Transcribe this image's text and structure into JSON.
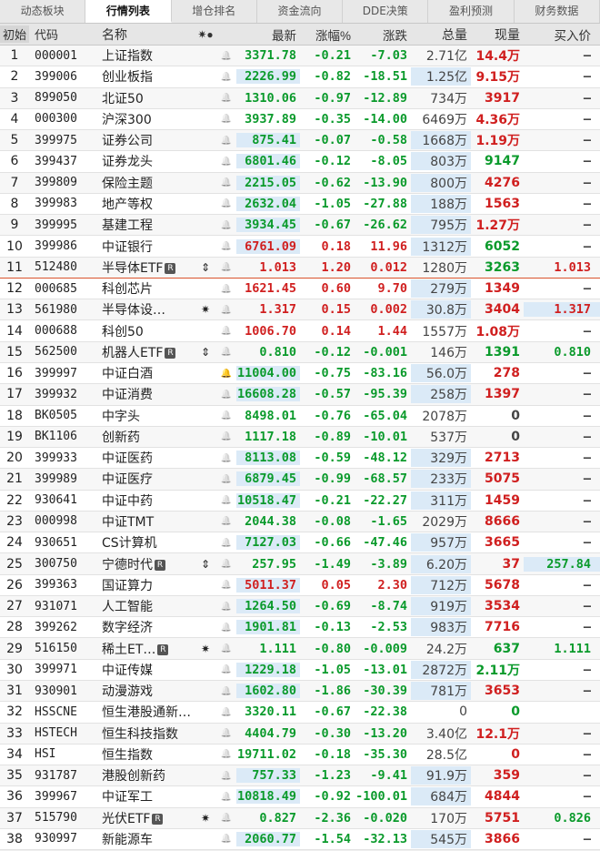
{
  "tabs": [
    "动态板块",
    "行情列表",
    "增仓排名",
    "资金流向",
    "DDE决策",
    "盈利预测",
    "财务数据"
  ],
  "active_tab": 1,
  "header": {
    "idx": "初始",
    "code": "代码",
    "name": "名称",
    "mark": "✷●",
    "latest": "最新",
    "pct": "涨幅%",
    "chg": "涨跌",
    "vol": "总量",
    "cur": "现量",
    "buy": "买入价"
  },
  "colors": {
    "up": "#d01f1f",
    "down": "#0a9a2b",
    "highlight": "#dbeaf7",
    "separator": "#d9532c"
  },
  "rows": [
    {
      "i": "1",
      "code": "000001",
      "name": "上证指数",
      "mark": "",
      "bell": "off",
      "latest": "3371.78",
      "pct": "-0.21",
      "chg": "-7.03",
      "vol": "2.71亿",
      "cur": "14.4万",
      "cur_c": "red",
      "buy": "—",
      "dir": "down",
      "hl": []
    },
    {
      "i": "2",
      "code": "399006",
      "name": "创业板指",
      "mark": "",
      "bell": "off",
      "latest": "2226.99",
      "pct": "-0.82",
      "chg": "-18.51",
      "vol": "1.25亿",
      "cur": "9.15万",
      "cur_c": "red",
      "buy": "—",
      "dir": "down",
      "hl": [
        "latest",
        "vol"
      ]
    },
    {
      "i": "3",
      "code": "899050",
      "name": "北证50",
      "mark": "",
      "bell": "off",
      "latest": "1310.06",
      "pct": "-0.97",
      "chg": "-12.89",
      "vol": "734万",
      "cur": "3917",
      "cur_c": "red",
      "buy": "—",
      "dir": "down",
      "hl": []
    },
    {
      "i": "4",
      "code": "000300",
      "name": "沪深300",
      "mark": "",
      "bell": "off",
      "latest": "3937.89",
      "pct": "-0.35",
      "chg": "-14.00",
      "vol": "6469万",
      "cur": "4.36万",
      "cur_c": "red",
      "buy": "—",
      "dir": "down",
      "hl": []
    },
    {
      "i": "5",
      "code": "399975",
      "name": "证券公司",
      "mark": "",
      "bell": "off",
      "latest": "875.41",
      "pct": "-0.07",
      "chg": "-0.58",
      "vol": "1668万",
      "cur": "1.19万",
      "cur_c": "red",
      "buy": "—",
      "dir": "down",
      "hl": [
        "latest",
        "vol"
      ]
    },
    {
      "i": "6",
      "code": "399437",
      "name": "证券龙头",
      "mark": "",
      "bell": "off",
      "latest": "6801.46",
      "pct": "-0.12",
      "chg": "-8.05",
      "vol": "803万",
      "cur": "9147",
      "cur_c": "green",
      "buy": "—",
      "dir": "down",
      "hl": [
        "latest",
        "vol"
      ]
    },
    {
      "i": "7",
      "code": "399809",
      "name": "保险主题",
      "mark": "",
      "bell": "off",
      "latest": "2215.05",
      "pct": "-0.62",
      "chg": "-13.90",
      "vol": "800万",
      "cur": "4276",
      "cur_c": "red",
      "buy": "—",
      "dir": "down",
      "hl": [
        "latest",
        "vol"
      ]
    },
    {
      "i": "8",
      "code": "399983",
      "name": "地产等权",
      "mark": "",
      "bell": "off",
      "latest": "2632.04",
      "pct": "-1.05",
      "chg": "-27.88",
      "vol": "188万",
      "cur": "1563",
      "cur_c": "red",
      "buy": "—",
      "dir": "down",
      "hl": [
        "latest",
        "vol"
      ]
    },
    {
      "i": "9",
      "code": "399995",
      "name": "基建工程",
      "mark": "",
      "bell": "off",
      "latest": "3934.45",
      "pct": "-0.67",
      "chg": "-26.62",
      "vol": "795万",
      "cur": "1.27万",
      "cur_c": "red",
      "buy": "—",
      "dir": "down",
      "hl": [
        "latest",
        "vol"
      ]
    },
    {
      "i": "10",
      "code": "399986",
      "name": "中证银行",
      "mark": "",
      "bell": "off",
      "latest": "6761.09",
      "pct": "0.18",
      "chg": "11.96",
      "vol": "1312万",
      "cur": "6052",
      "cur_c": "green",
      "buy": "—",
      "dir": "up",
      "hl": [
        "latest",
        "vol"
      ]
    },
    {
      "i": "11",
      "code": "512480",
      "name": "半导体ETF",
      "badge": "R",
      "mark": "⇕",
      "bell": "off",
      "latest": "1.013",
      "pct": "1.20",
      "chg": "0.012",
      "vol": "1280万",
      "cur": "3263",
      "cur_c": "green",
      "buy": "1.013",
      "buy_c": "red",
      "dir": "up",
      "hl": []
    },
    {
      "i": "12",
      "code": "000685",
      "name": "科创芯片",
      "mark": "",
      "bell": "off",
      "latest": "1621.45",
      "pct": "0.60",
      "chg": "9.70",
      "vol": "279万",
      "cur": "1349",
      "cur_c": "red",
      "buy": "—",
      "dir": "up",
      "hl": [
        "vol"
      ]
    },
    {
      "i": "13",
      "code": "561980",
      "name": "半导体设…",
      "mark": "✷",
      "bell": "off",
      "latest": "1.317",
      "pct": "0.15",
      "chg": "0.002",
      "vol": "30.8万",
      "cur": "3404",
      "cur_c": "red",
      "buy": "1.317",
      "buy_c": "red",
      "dir": "up",
      "hl": [
        "vol",
        "buy"
      ]
    },
    {
      "i": "14",
      "code": "000688",
      "name": "科创50",
      "mark": "",
      "bell": "off",
      "latest": "1006.70",
      "pct": "0.14",
      "chg": "1.44",
      "vol": "1557万",
      "cur": "1.08万",
      "cur_c": "red",
      "buy": "—",
      "dir": "up",
      "hl": []
    },
    {
      "i": "15",
      "code": "562500",
      "name": "机器人ETF",
      "badge": "R",
      "mark": "⇕",
      "bell": "off",
      "latest": "0.810",
      "pct": "-0.12",
      "chg": "-0.001",
      "vol": "146万",
      "cur": "1391",
      "cur_c": "green",
      "buy": "0.810",
      "buy_c": "green",
      "dir": "down",
      "hl": []
    },
    {
      "i": "16",
      "code": "399997",
      "name": "中证白酒",
      "mark": "",
      "bell": "on",
      "latest": "11004.00",
      "pct": "-0.75",
      "chg": "-83.16",
      "vol": "56.0万",
      "cur": "278",
      "cur_c": "red",
      "buy": "—",
      "dir": "down",
      "hl": [
        "latest",
        "vol"
      ]
    },
    {
      "i": "17",
      "code": "399932",
      "name": "中证消费",
      "mark": "",
      "bell": "off",
      "latest": "16608.28",
      "pct": "-0.57",
      "chg": "-95.39",
      "vol": "258万",
      "cur": "1397",
      "cur_c": "red",
      "buy": "—",
      "dir": "down",
      "hl": [
        "latest",
        "vol"
      ]
    },
    {
      "i": "18",
      "code": "BK0505",
      "name": "中字头",
      "mark": "",
      "bell": "off",
      "latest": "8498.01",
      "pct": "-0.76",
      "chg": "-65.04",
      "vol": "2078万",
      "cur": "0",
      "cur_c": "gray",
      "buy": "—",
      "dir": "down",
      "hl": []
    },
    {
      "i": "19",
      "code": "BK1106",
      "name": "创新药",
      "mark": "",
      "bell": "off",
      "latest": "1117.18",
      "pct": "-0.89",
      "chg": "-10.01",
      "vol": "537万",
      "cur": "0",
      "cur_c": "gray",
      "buy": "—",
      "dir": "down",
      "hl": []
    },
    {
      "i": "20",
      "code": "399933",
      "name": "中证医药",
      "mark": "",
      "bell": "off",
      "latest": "8113.08",
      "pct": "-0.59",
      "chg": "-48.12",
      "vol": "329万",
      "cur": "2713",
      "cur_c": "red",
      "buy": "—",
      "dir": "down",
      "hl": [
        "latest",
        "vol"
      ]
    },
    {
      "i": "21",
      "code": "399989",
      "name": "中证医疗",
      "mark": "",
      "bell": "off",
      "latest": "6879.45",
      "pct": "-0.99",
      "chg": "-68.57",
      "vol": "233万",
      "cur": "5075",
      "cur_c": "red",
      "buy": "—",
      "dir": "down",
      "hl": [
        "latest",
        "vol"
      ]
    },
    {
      "i": "22",
      "code": "930641",
      "name": "中证中药",
      "mark": "",
      "bell": "off",
      "latest": "10518.47",
      "pct": "-0.21",
      "chg": "-22.27",
      "vol": "311万",
      "cur": "1459",
      "cur_c": "red",
      "buy": "—",
      "dir": "down",
      "hl": [
        "latest",
        "vol"
      ]
    },
    {
      "i": "23",
      "code": "000998",
      "name": "中证TMT",
      "mark": "",
      "bell": "off",
      "latest": "2044.38",
      "pct": "-0.08",
      "chg": "-1.65",
      "vol": "2029万",
      "cur": "8666",
      "cur_c": "red",
      "buy": "—",
      "dir": "down",
      "hl": []
    },
    {
      "i": "24",
      "code": "930651",
      "name": "CS计算机",
      "mark": "",
      "bell": "off",
      "latest": "7127.03",
      "pct": "-0.66",
      "chg": "-47.46",
      "vol": "957万",
      "cur": "3665",
      "cur_c": "red",
      "buy": "—",
      "dir": "down",
      "hl": [
        "latest",
        "vol"
      ]
    },
    {
      "i": "25",
      "code": "300750",
      "name": "宁德时代",
      "badge": "R",
      "mark": "⇕",
      "bell": "off",
      "latest": "257.95",
      "pct": "-1.49",
      "chg": "-3.89",
      "vol": "6.20万",
      "cur": "37",
      "cur_c": "red",
      "buy": "257.84",
      "buy_c": "green",
      "dir": "down",
      "hl": [
        "vol",
        "buy"
      ]
    },
    {
      "i": "26",
      "code": "399363",
      "name": "国证算力",
      "mark": "",
      "bell": "off",
      "latest": "5011.37",
      "pct": "0.05",
      "chg": "2.30",
      "vol": "712万",
      "cur": "5678",
      "cur_c": "red",
      "buy": "—",
      "dir": "up",
      "hl": [
        "latest",
        "vol"
      ]
    },
    {
      "i": "27",
      "code": "931071",
      "name": "人工智能",
      "mark": "",
      "bell": "off",
      "latest": "1264.50",
      "pct": "-0.69",
      "chg": "-8.74",
      "vol": "919万",
      "cur": "3534",
      "cur_c": "red",
      "buy": "—",
      "dir": "down",
      "hl": [
        "latest",
        "vol"
      ]
    },
    {
      "i": "28",
      "code": "399262",
      "name": "数字经济",
      "mark": "",
      "bell": "off",
      "latest": "1901.81",
      "pct": "-0.13",
      "chg": "-2.53",
      "vol": "983万",
      "cur": "7716",
      "cur_c": "red",
      "buy": "—",
      "dir": "down",
      "hl": [
        "latest",
        "vol"
      ]
    },
    {
      "i": "29",
      "code": "516150",
      "name": "稀土ET…",
      "badge": "R",
      "mark": "✷",
      "bell": "off",
      "latest": "1.111",
      "pct": "-0.80",
      "chg": "-0.009",
      "vol": "24.2万",
      "cur": "637",
      "cur_c": "green",
      "buy": "1.111",
      "buy_c": "green",
      "dir": "down",
      "hl": []
    },
    {
      "i": "30",
      "code": "399971",
      "name": "中证传媒",
      "mark": "",
      "bell": "off",
      "latest": "1229.18",
      "pct": "-1.05",
      "chg": "-13.01",
      "vol": "2872万",
      "cur": "2.11万",
      "cur_c": "green",
      "buy": "—",
      "dir": "down",
      "hl": [
        "latest",
        "vol"
      ]
    },
    {
      "i": "31",
      "code": "930901",
      "name": "动漫游戏",
      "mark": "",
      "bell": "off",
      "latest": "1602.80",
      "pct": "-1.86",
      "chg": "-30.39",
      "vol": "781万",
      "cur": "3653",
      "cur_c": "red",
      "buy": "—",
      "dir": "down",
      "hl": [
        "latest",
        "vol"
      ]
    },
    {
      "i": "32",
      "code": "HSSCNE",
      "name": "恒生港股通新…",
      "mark": "",
      "bell": "off",
      "latest": "3320.11",
      "pct": "-0.67",
      "chg": "-22.38",
      "vol": "0",
      "cur": "0",
      "cur_c": "green",
      "buy": "",
      "dir": "down",
      "hl": []
    },
    {
      "i": "33",
      "code": "HSTECH",
      "name": "恒生科技指数",
      "mark": "",
      "bell": "off",
      "latest": "4404.79",
      "pct": "-0.30",
      "chg": "-13.20",
      "vol": "3.40亿",
      "cur": "12.1万",
      "cur_c": "red",
      "buy": "—",
      "dir": "down",
      "hl": []
    },
    {
      "i": "34",
      "code": "HSI",
      "name": "恒生指数",
      "mark": "",
      "bell": "off",
      "latest": "19711.02",
      "pct": "-0.18",
      "chg": "-35.30",
      "vol": "28.5亿",
      "cur": "0",
      "cur_c": "red",
      "buy": "—",
      "dir": "down",
      "hl": []
    },
    {
      "i": "35",
      "code": "931787",
      "name": "港股创新药",
      "mark": "",
      "bell": "off",
      "latest": "757.33",
      "pct": "-1.23",
      "chg": "-9.41",
      "vol": "91.9万",
      "cur": "359",
      "cur_c": "red",
      "buy": "—",
      "dir": "down",
      "hl": [
        "latest",
        "vol"
      ]
    },
    {
      "i": "36",
      "code": "399967",
      "name": "中证军工",
      "mark": "",
      "bell": "off",
      "latest": "10818.49",
      "pct": "-0.92",
      "chg": "-100.01",
      "vol": "684万",
      "cur": "4844",
      "cur_c": "red",
      "buy": "—",
      "dir": "down",
      "hl": [
        "latest",
        "vol"
      ]
    },
    {
      "i": "37",
      "code": "515790",
      "name": "光伏ETF",
      "badge": "R",
      "mark": "✷",
      "bell": "off",
      "latest": "0.827",
      "pct": "-2.36",
      "chg": "-0.020",
      "vol": "170万",
      "cur": "5751",
      "cur_c": "red",
      "buy": "0.826",
      "buy_c": "green",
      "dir": "down",
      "hl": []
    },
    {
      "i": "38",
      "code": "930997",
      "name": "新能源车",
      "mark": "",
      "bell": "off",
      "latest": "2060.77",
      "pct": "-1.54",
      "chg": "-32.13",
      "vol": "545万",
      "cur": "3866",
      "cur_c": "red",
      "buy": "—",
      "dir": "down",
      "hl": [
        "latest",
        "vol"
      ]
    }
  ]
}
